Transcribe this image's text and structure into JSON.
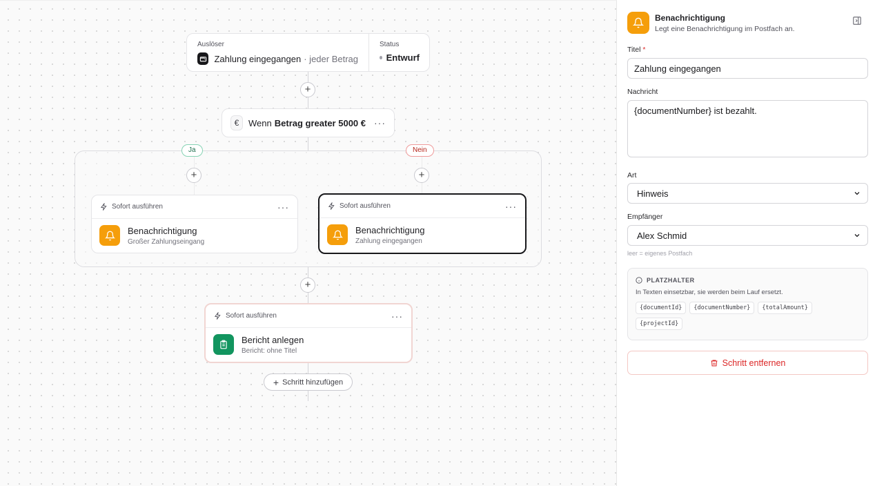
{
  "trigger": {
    "label": "Auslöser",
    "event": "Zahlung eingegangen",
    "qualifier": "· jeder Betrag",
    "status_label": "Status",
    "status_value": "Entwurf"
  },
  "condition": {
    "prefix": "Wenn",
    "expression": "Betrag greater 5000 €",
    "icon": "euro-icon"
  },
  "branches": {
    "yes_label": "Ja",
    "no_label": "Nein"
  },
  "actions": [
    {
      "mode": "Sofort ausführen",
      "title": "Benachrichtigung",
      "subtitle": "Großer Zahlungseingang",
      "icon": "bell-icon",
      "color": "#f59e0b"
    },
    {
      "mode": "Sofort ausführen",
      "title": "Benachrichtigung",
      "subtitle": "Zahlung eingegangen",
      "icon": "bell-icon",
      "color": "#f59e0b"
    },
    {
      "mode": "Sofort ausführen",
      "title": "Bericht anlegen",
      "subtitle": "Bericht: ohne Titel",
      "icon": "clipboard-icon",
      "color": "#12955f"
    }
  ],
  "add_step_label": "Schritt hinzufügen",
  "panel": {
    "title": "Benachrichtigung",
    "subtitle": "Legt eine Benachrichtigung im Postfach an.",
    "fields": {
      "title_label": "Titel",
      "title_required": "*",
      "title_value": "Zahlung eingegangen",
      "message_label": "Nachricht",
      "message_value": "{documentNumber} ist bezahlt.",
      "type_label": "Art",
      "type_value": "Hinweis",
      "recipient_label": "Empfänger",
      "recipient_value": "Alex Schmid",
      "recipient_hint": "leer = eigenes Postfach"
    },
    "placeholders": {
      "title": "PLATZHALTER",
      "description": "In Texten einsetzbar, sie werden beim Lauf ersetzt.",
      "items": [
        "{documentId}",
        "{documentNumber}",
        "{totalAmount}",
        "{projectId}"
      ]
    },
    "remove_label": "Schritt entfernen"
  },
  "colors": {
    "accent_orange": "#f59e0b",
    "accent_green": "#12955f",
    "danger": "#dc2626"
  }
}
